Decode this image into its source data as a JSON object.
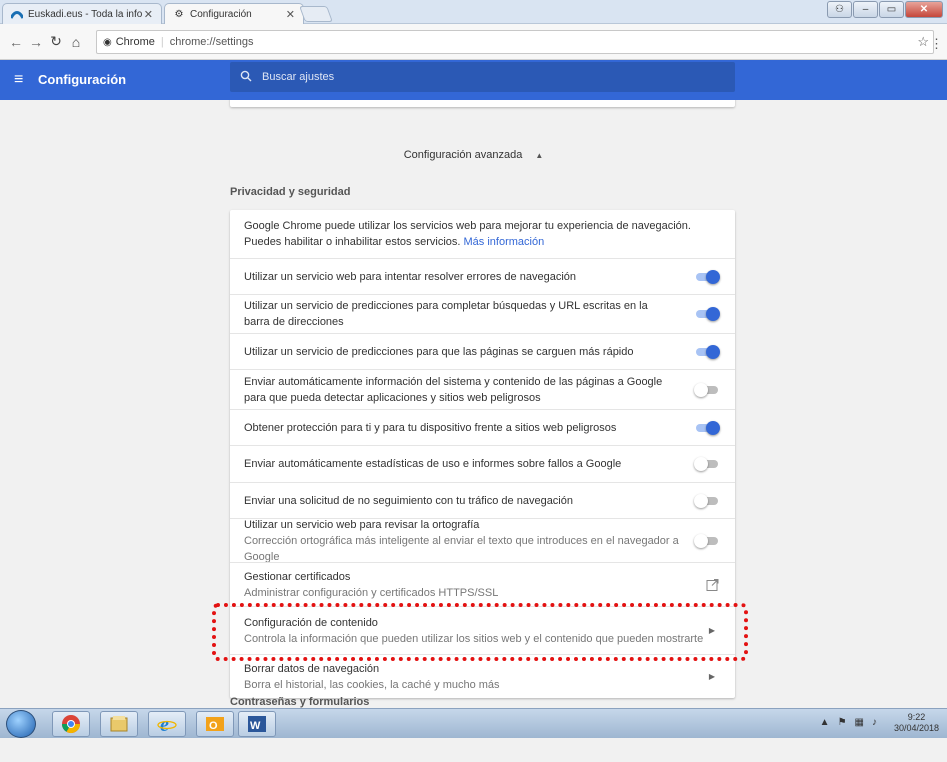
{
  "browser": {
    "tabs": [
      {
        "title": "Euskadi.eus - Toda la info",
        "active": false
      },
      {
        "title": "Configuración",
        "active": true
      }
    ],
    "address": {
      "security_label": "Chrome",
      "url": "chrome://settings"
    }
  },
  "settings": {
    "header_title": "Configuración",
    "search_placeholder": "Buscar ajustes",
    "advanced_label": "Configuración avanzada",
    "privacy_title": "Privacidad y seguridad",
    "intro_text": "Google Chrome puede utilizar los servicios web para mejorar tu experiencia de navegación. Puedes habilitar o inhabilitar estos servicios.",
    "intro_link": "Más información",
    "toggles": [
      {
        "label": "Utilizar un servicio web para intentar resolver errores de navegación",
        "sub": "",
        "on": true
      },
      {
        "label": "Utilizar un servicio de predicciones para completar búsquedas y URL escritas en la barra de direcciones",
        "sub": "",
        "on": true
      },
      {
        "label": "Utilizar un servicio de predicciones para que las páginas se carguen más rápido",
        "sub": "",
        "on": true
      },
      {
        "label": "Enviar automáticamente información del sistema y contenido de las páginas a Google para que pueda detectar aplicaciones y sitios web peligrosos",
        "sub": "",
        "on": false
      },
      {
        "label": "Obtener protección para ti y para tu dispositivo frente a sitios web peligrosos",
        "sub": "",
        "on": true
      },
      {
        "label": "Enviar automáticamente estadísticas de uso e informes sobre fallos a Google",
        "sub": "",
        "on": false
      },
      {
        "label": "Enviar una solicitud de no seguimiento con tu tráfico de navegación",
        "sub": "",
        "on": false
      },
      {
        "label": "Utilizar un servicio web para revisar la ortografía",
        "sub": "Corrección ortográfica más inteligente al enviar el texto que introduces en el navegador a Google",
        "on": false
      }
    ],
    "certificates": {
      "label": "Gestionar certificados",
      "sub": "Administrar configuración y certificados HTTPS/SSL"
    },
    "content_settings": {
      "label": "Configuración de contenido",
      "sub": "Controla la información que pueden utilizar los sitios web y el contenido que pueden mostrarte"
    },
    "clear_data": {
      "label": "Borrar datos de navegación",
      "sub": "Borra el historial, las cookies, la caché y mucho más"
    },
    "passwords_title": "Contraseñas y formularios"
  },
  "taskbar": {
    "clock_time": "9:22",
    "clock_date": "30/04/2018",
    "apps": [
      "chrome-icon",
      "explorer-icon",
      "ie-icon",
      "outlook-icon",
      "word-icon"
    ]
  },
  "colors": {
    "accent": "#3367d6",
    "highlight": "#e31212"
  }
}
